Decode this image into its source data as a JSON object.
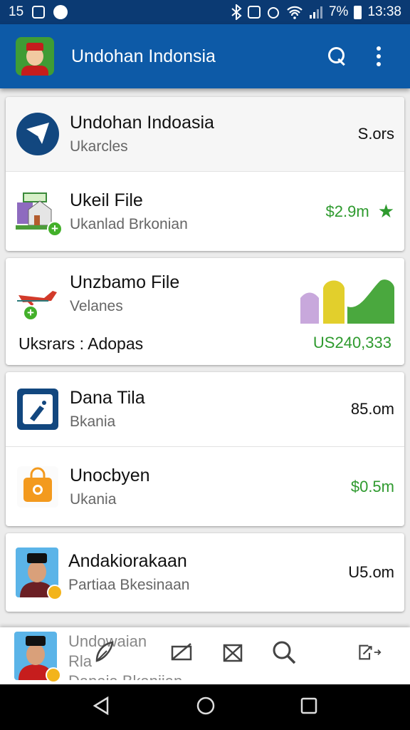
{
  "status_bar": {
    "time_left": "15",
    "battery": "7%",
    "clock": "13:38"
  },
  "app_bar": {
    "title": "Undohan Indonsia"
  },
  "cards": [
    {
      "rows": [
        {
          "title": "Undohan Indoasia",
          "subtitle": "Ukarcles",
          "value": "S.ors",
          "value_color": "#111111"
        },
        {
          "title": "Ukeil File",
          "subtitle": "Ukanlad Brkonian",
          "value": "$2.9m",
          "value_color": "#2e9a2e",
          "starred": true
        }
      ]
    },
    {
      "rows": [
        {
          "title": "Unzbamo File",
          "subtitle": "Velanes",
          "footer_label": "Uksrars : Adopas",
          "value": "US240,333",
          "value_color": "#2e9a2e"
        }
      ]
    },
    {
      "rows": [
        {
          "title": "Dana Tila",
          "subtitle": "Bkania",
          "value": "85.om",
          "value_color": "#111111"
        },
        {
          "title": "Unocbyen",
          "subtitle": "Ukania",
          "value": "$0.5m",
          "value_color": "#2e9a2e"
        }
      ]
    },
    {
      "rows": [
        {
          "title": "Andakiorakaan",
          "subtitle": "Partiaa Bkesinaan",
          "value": "U5.om",
          "value_color": "#111111"
        }
      ]
    }
  ],
  "bottom_nav": {
    "peek_line1": "Undowaian",
    "peek_line2": "Rla",
    "peek_line3": "Danaia Bkaniian"
  },
  "colors": {
    "status_bar": "#0b3a73",
    "app_bar": "#0d5aa7",
    "accent_green": "#2e9a2e"
  },
  "icons": [
    "wifi-icon",
    "search-icon",
    "more-vert-icon",
    "star-icon",
    "nav-back-icon",
    "nav-home-icon",
    "nav-recents-icon"
  ]
}
